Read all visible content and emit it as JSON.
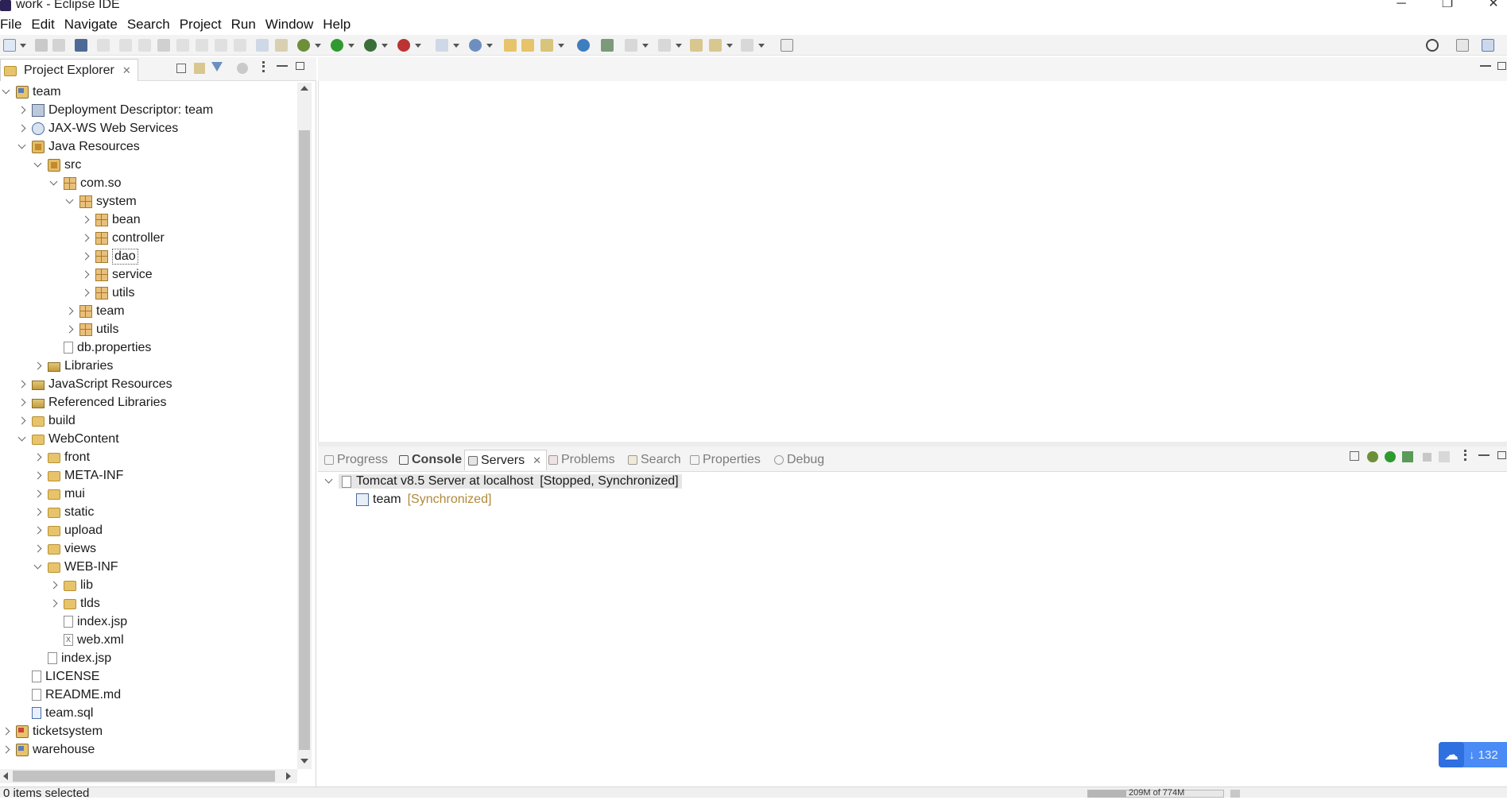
{
  "window": {
    "title": "work - Eclipse IDE",
    "minimize": "─",
    "maximize": "❐",
    "close": "✕"
  },
  "menu": [
    "File",
    "Edit",
    "Navigate",
    "Search",
    "Project",
    "Run",
    "Window",
    "Help"
  ],
  "left_panel": {
    "tab_label": "Project Explorer",
    "tree": [
      {
        "label": "team",
        "depth": 0,
        "state": "open",
        "icon": "project"
      },
      {
        "label": "Deployment Descriptor: team",
        "depth": 1,
        "state": "closed",
        "icon": "descr"
      },
      {
        "label": "JAX-WS Web Services",
        "depth": 1,
        "state": "closed",
        "icon": "ws"
      },
      {
        "label": "Java Resources",
        "depth": 1,
        "state": "open",
        "icon": "pkgroot"
      },
      {
        "label": "src",
        "depth": 2,
        "state": "open",
        "icon": "pkgroot"
      },
      {
        "label": "com.so",
        "depth": 3,
        "state": "open",
        "icon": "pkg"
      },
      {
        "label": "system",
        "depth": 4,
        "state": "open",
        "icon": "pkg"
      },
      {
        "label": "bean",
        "depth": 5,
        "state": "closed",
        "icon": "pkg"
      },
      {
        "label": "controller",
        "depth": 5,
        "state": "closed",
        "icon": "pkg"
      },
      {
        "label": "dao",
        "depth": 5,
        "state": "closed",
        "icon": "pkg",
        "selected": true
      },
      {
        "label": "service",
        "depth": 5,
        "state": "closed",
        "icon": "pkg"
      },
      {
        "label": "utils",
        "depth": 5,
        "state": "closed",
        "icon": "pkg"
      },
      {
        "label": "team",
        "depth": 4,
        "state": "closed",
        "icon": "pkg"
      },
      {
        "label": "utils",
        "depth": 4,
        "state": "closed",
        "icon": "pkg"
      },
      {
        "label": "db.properties",
        "depth": 3,
        "state": "none",
        "icon": "file"
      },
      {
        "label": "Libraries",
        "depth": 2,
        "state": "closed",
        "icon": "lib"
      },
      {
        "label": "JavaScript Resources",
        "depth": 1,
        "state": "closed",
        "icon": "lib"
      },
      {
        "label": "Referenced Libraries",
        "depth": 1,
        "state": "closed",
        "icon": "lib"
      },
      {
        "label": "build",
        "depth": 1,
        "state": "closed",
        "icon": "folder"
      },
      {
        "label": "WebContent",
        "depth": 1,
        "state": "open",
        "icon": "folder"
      },
      {
        "label": "front",
        "depth": 2,
        "state": "closed",
        "icon": "folder"
      },
      {
        "label": "META-INF",
        "depth": 2,
        "state": "closed",
        "icon": "folder"
      },
      {
        "label": "mui",
        "depth": 2,
        "state": "closed",
        "icon": "folder"
      },
      {
        "label": "static",
        "depth": 2,
        "state": "closed",
        "icon": "folder"
      },
      {
        "label": "upload",
        "depth": 2,
        "state": "closed",
        "icon": "folder"
      },
      {
        "label": "views",
        "depth": 2,
        "state": "closed",
        "icon": "folder"
      },
      {
        "label": "WEB-INF",
        "depth": 2,
        "state": "open",
        "icon": "folder"
      },
      {
        "label": "lib",
        "depth": 3,
        "state": "closed",
        "icon": "folder"
      },
      {
        "label": "tlds",
        "depth": 3,
        "state": "closed",
        "icon": "folder"
      },
      {
        "label": "index.jsp",
        "depth": 3,
        "state": "none",
        "icon": "file"
      },
      {
        "label": "web.xml",
        "depth": 3,
        "state": "none",
        "icon": "xml"
      },
      {
        "label": "index.jsp",
        "depth": 2,
        "state": "none",
        "icon": "file"
      },
      {
        "label": "LICENSE",
        "depth": 1,
        "state": "none",
        "icon": "file"
      },
      {
        "label": "README.md",
        "depth": 1,
        "state": "none",
        "icon": "file"
      },
      {
        "label": "team.sql",
        "depth": 1,
        "state": "none",
        "icon": "sql"
      },
      {
        "label": "ticketsystem",
        "depth": 0,
        "state": "closed",
        "icon": "project-red"
      },
      {
        "label": "warehouse",
        "depth": 0,
        "state": "closed",
        "icon": "project"
      }
    ]
  },
  "bottom_panel": {
    "tabs": [
      {
        "label": "Progress",
        "active": false
      },
      {
        "label": "Console",
        "active": false,
        "bold": true
      },
      {
        "label": "Servers",
        "active": true
      },
      {
        "label": "Problems",
        "active": false
      },
      {
        "label": "Search",
        "active": false
      },
      {
        "label": "Properties",
        "active": false
      },
      {
        "label": "Debug",
        "active": false
      }
    ],
    "server": {
      "name": "Tomcat v8.5 Server at localhost",
      "status": "[Stopped, Synchronized]",
      "child_name": "team",
      "child_status": "[Synchronized]"
    }
  },
  "status_bar": {
    "left_text": "0 items selected",
    "heap": "209M of 774M"
  },
  "cloud_widget": {
    "count": "↓ 132"
  },
  "colors": {
    "accent": "#4a8bf6",
    "status_gold": "#b08a3a",
    "selection_bg": "#e6e6e6"
  }
}
